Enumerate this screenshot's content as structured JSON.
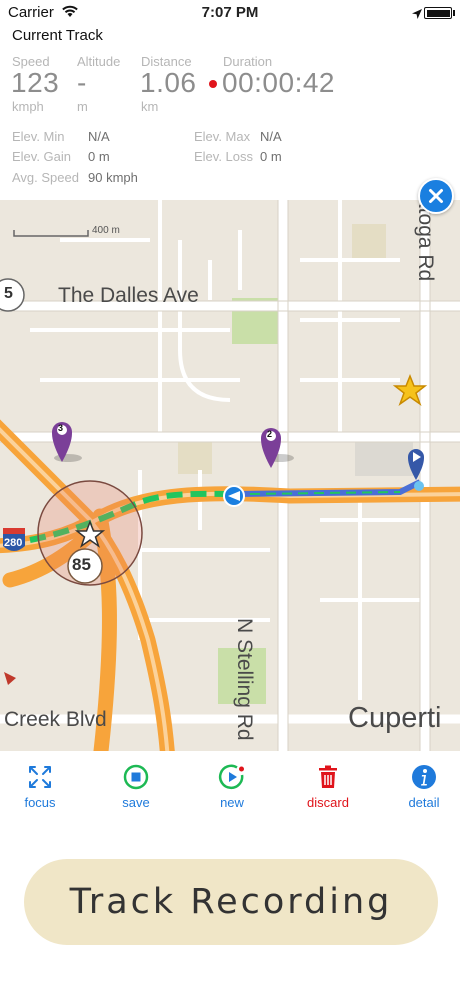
{
  "status_bar": {
    "carrier": "Carrier",
    "time": "7:07 PM",
    "icons": [
      "wifi-icon",
      "location-arrow-icon",
      "battery-icon"
    ]
  },
  "track": {
    "title": "Current Track",
    "speed": {
      "label": "Speed",
      "value": "123",
      "unit": "kmph"
    },
    "altitude": {
      "label": "Altitude",
      "value": "-",
      "unit": "m"
    },
    "distance": {
      "label": "Distance",
      "value": "1.06",
      "unit": "km"
    },
    "duration": {
      "label": "Duration",
      "value": "00:00:42"
    },
    "stats": {
      "elev_min": {
        "label": "Elev. Min",
        "value": "N/A"
      },
      "elev_max": {
        "label": "Elev. Max",
        "value": "N/A"
      },
      "elev_gain": {
        "label": "Elev. Gain",
        "value": "0 m"
      },
      "elev_loss": {
        "label": "Elev. Loss",
        "value": "0 m"
      },
      "avg_speed": {
        "label": "Avg. Speed",
        "value": "90 kmph"
      }
    }
  },
  "map": {
    "scale_label": "400 m",
    "streets": [
      "The Dalles Ave",
      "N Stelling Rd",
      "Creek Blvd",
      "atoga Rd",
      "Cuperti"
    ],
    "route_shields": [
      "85",
      "280",
      "5"
    ],
    "pins": [
      "3",
      "2"
    ],
    "colors": {
      "route_done": "#22c55e",
      "route_live": "#4a6fd6",
      "highway": "#f7a43b",
      "pin": "#7b3f98"
    }
  },
  "toolbar": {
    "focus": "focus",
    "save": "save",
    "new": "new",
    "discard": "discard",
    "detail": "detail",
    "colors": {
      "primary": "#1f7adb",
      "save": "#1db954",
      "discard": "#e0141b"
    }
  },
  "record_button": {
    "label": "Track Recording"
  }
}
